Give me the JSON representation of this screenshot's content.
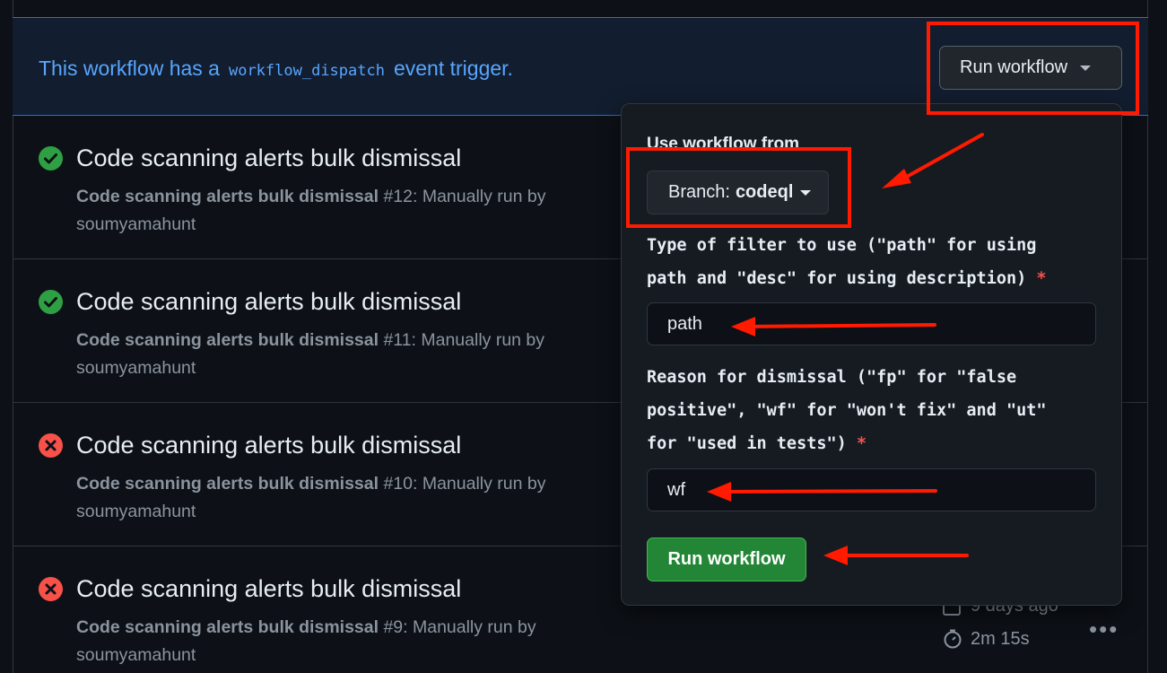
{
  "banner": {
    "text_before": "This workflow has a",
    "code": "workflow_dispatch",
    "text_after": "event trigger.",
    "run_button_label": "Run workflow"
  },
  "runs": [
    {
      "status": "success",
      "title": "Code scanning alerts bulk dismissal",
      "meta_workflow": "Code scanning alerts bulk dismissal",
      "meta_run": "#12: Manually run by",
      "meta_user": "soumyamahunt"
    },
    {
      "status": "success",
      "title": "Code scanning alerts bulk dismissal",
      "meta_workflow": "Code scanning alerts bulk dismissal",
      "meta_run": "#11: Manually run by",
      "meta_user": "soumyamahunt"
    },
    {
      "status": "failure",
      "title": "Code scanning alerts bulk dismissal",
      "meta_workflow": "Code scanning alerts bulk dismissal",
      "meta_run": "#10: Manually run by",
      "meta_user": "soumyamahunt"
    },
    {
      "status": "failure",
      "title": "Code scanning alerts bulk dismissal",
      "meta_workflow": "Code scanning alerts bulk dismissal",
      "meta_run": "#9: Manually run by",
      "meta_user": "soumyamahunt"
    }
  ],
  "last_run_side": {
    "date": "9 days ago",
    "duration": "2m 15s",
    "more_icon": "kebab-horizontal-icon"
  },
  "dropdown": {
    "use_from_label": "Use workflow from",
    "branch_prefix": "Branch:",
    "branch_name": "codeql",
    "filter_label": "Type of filter to use (\"path\" for using path and \"desc\" for using description)",
    "filter_value": "path",
    "reason_label": "Reason for dismissal (\"fp\" for \"false positive\", \"wf\" for \"won't fix\" and \"ut\" for \"used in tests\")",
    "reason_value": "wf",
    "required_mark": "*",
    "submit_label": "Run workflow"
  },
  "colors": {
    "accent": "#58a6ff",
    "success": "#2ea043",
    "failure": "#f85149",
    "primary_button": "#238636",
    "annotation": "#ff1a00"
  }
}
